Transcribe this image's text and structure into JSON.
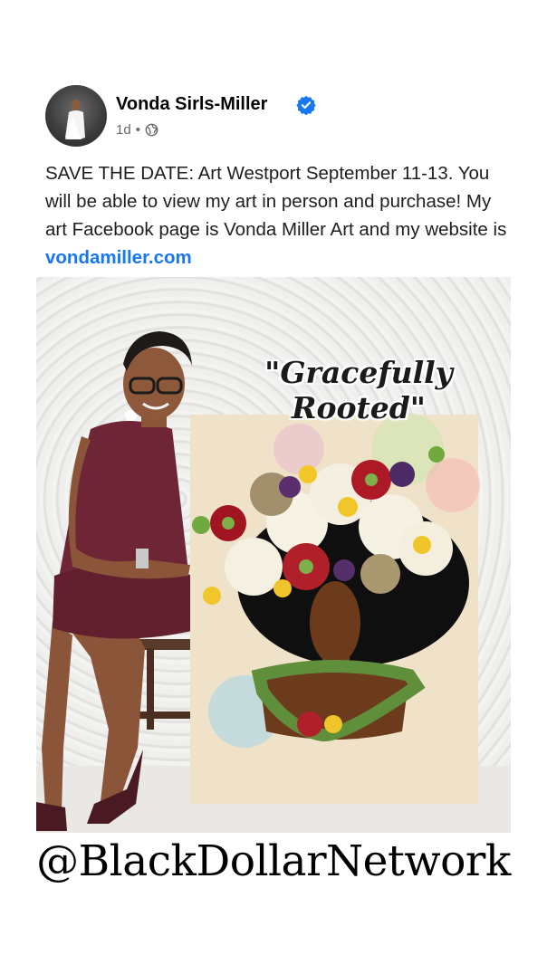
{
  "post": {
    "author": "Vonda Sirls-Miller",
    "verified_icon": "verified-badge-icon",
    "time_ago": "1d",
    "separator": "•",
    "audience_icon": "globe-icon",
    "text_before_link": "SAVE THE DATE: Art Westport September 11-13. You will be able to view my art in person and purchase! My art Facebook page is Vonda Miller Art and my website is ",
    "link_text": "vondamiller.com"
  },
  "photo": {
    "artwork_title": "\"Gracefully Rooted\""
  },
  "watermark": {
    "handle": "@BlackDollarNetwork"
  },
  "colors": {
    "link": "#1877f2",
    "verified": "#1877f2",
    "dress": "#6e2637"
  }
}
